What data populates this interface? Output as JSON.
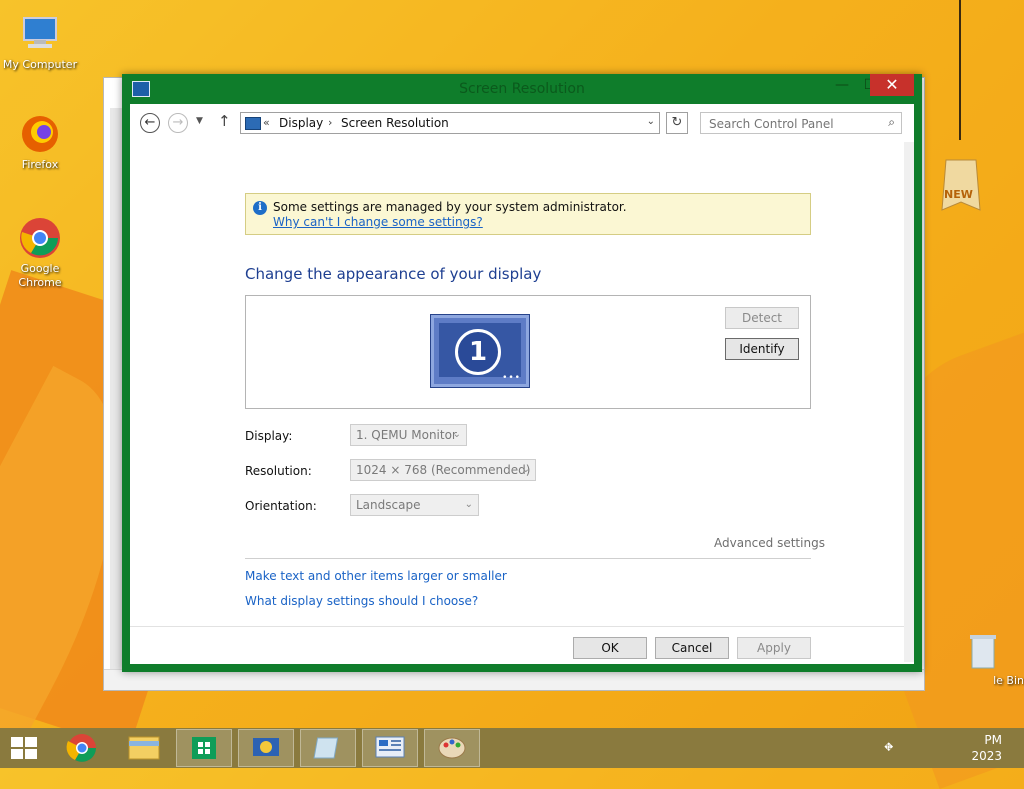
{
  "desktop": {
    "icons": [
      {
        "label": "My Computer"
      },
      {
        "label": "Firefox"
      },
      {
        "label": "Google Chrome"
      },
      {
        "label": "le Bin"
      }
    ],
    "badge": "NEW"
  },
  "window": {
    "title": "Screen Resolution",
    "controls": {
      "minimize": "—",
      "maximize": "☐",
      "close": "✕"
    },
    "address": {
      "separator": "«",
      "crumbs": [
        "Display",
        "Screen Resolution"
      ],
      "search_placeholder": "Search Control Panel"
    },
    "info": {
      "message": "Some settings are managed by your system administrator.",
      "link": "Why can't I change some settings?"
    },
    "heading": "Change the appearance of your display",
    "preview": {
      "monitor_number": "1",
      "detect_label": "Detect",
      "identify_label": "Identify"
    },
    "form": {
      "display_label": "Display:",
      "display_value": "1. QEMU Monitor",
      "resolution_label": "Resolution:",
      "resolution_value": "1024 × 768 (Recommended)",
      "orientation_label": "Orientation:",
      "orientation_value": "Landscape"
    },
    "advanced": "Advanced settings",
    "links": [
      "Make text and other items larger or smaller",
      "What display settings should I choose?"
    ],
    "buttons": {
      "ok": "OK",
      "cancel": "Cancel",
      "apply": "Apply"
    }
  },
  "taskbar": {
    "clock_time": "PM",
    "clock_date": "2023"
  },
  "colors": {
    "window_frame": "#0f7d2b",
    "link": "#1a63c6",
    "heading": "#1e3f91",
    "close": "#c7312b"
  }
}
